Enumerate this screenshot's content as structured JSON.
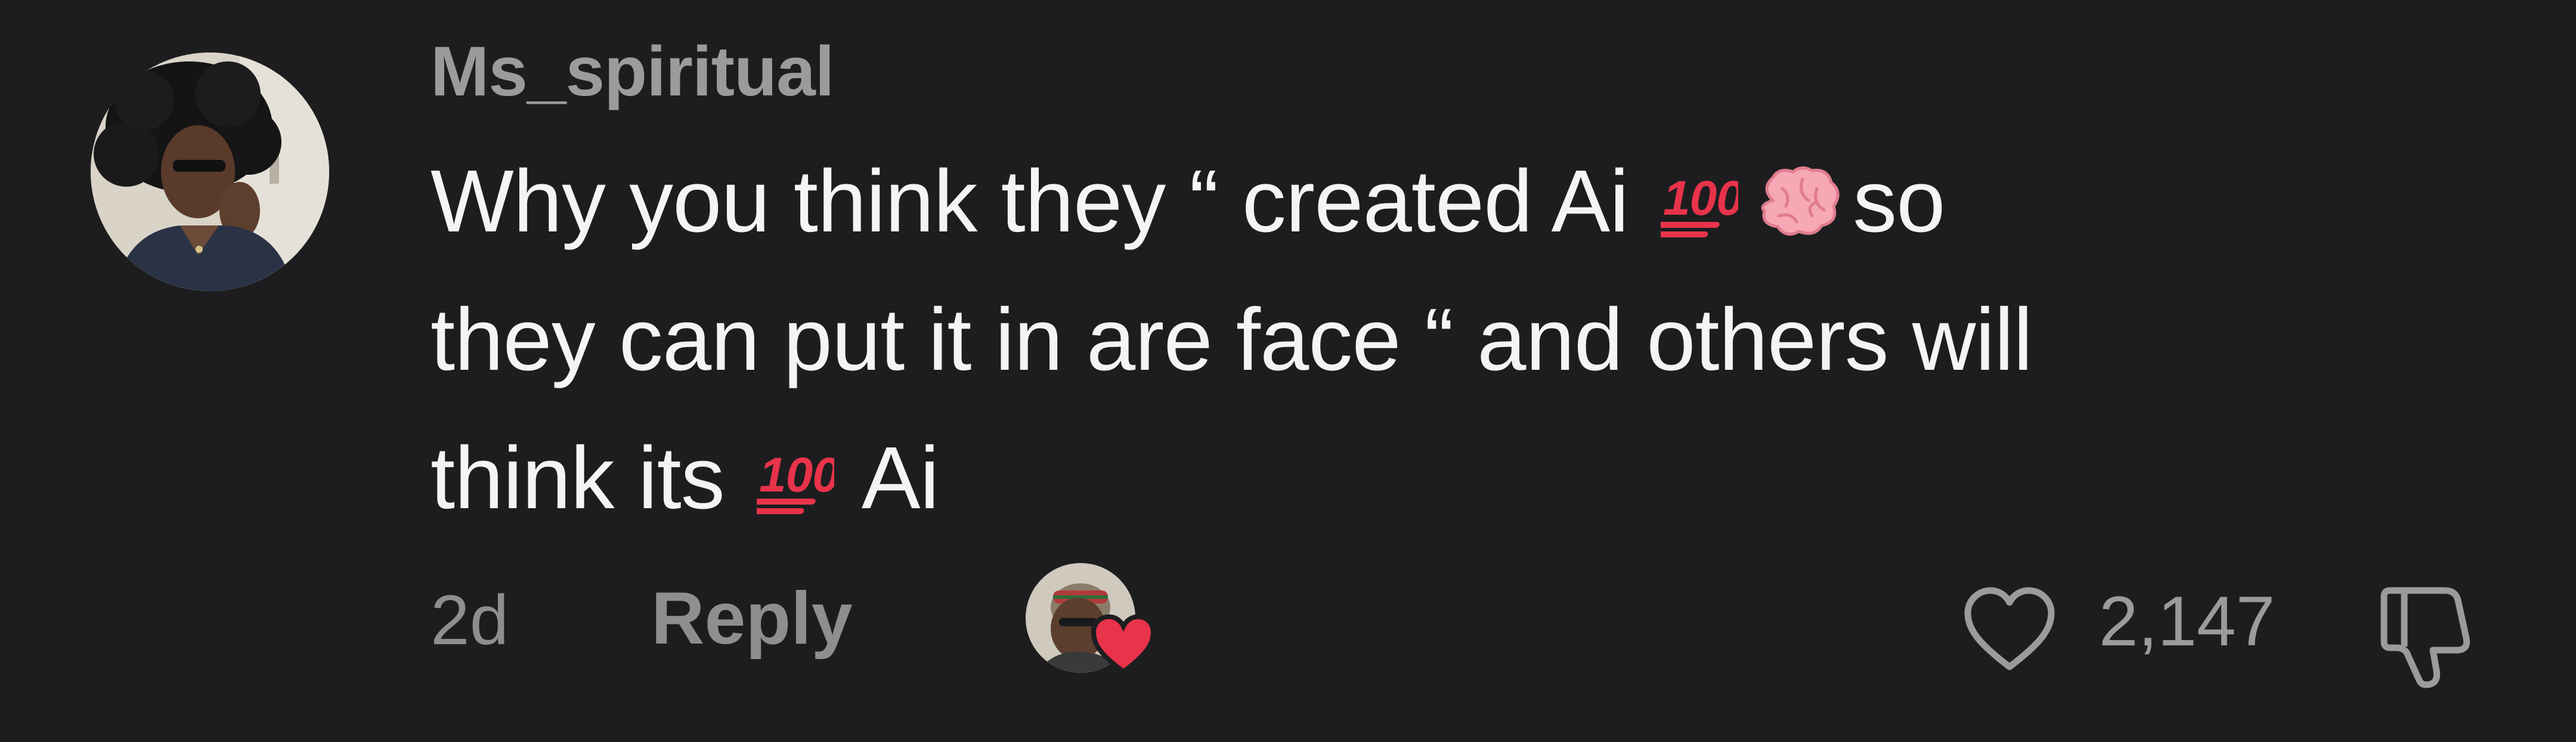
{
  "comment": {
    "username": "Ms_spiritual",
    "text_lines": [
      {
        "before": "Why you think they “ created Ai ",
        "after": "so"
      },
      {
        "text": "they can put it in are face “ and others will"
      },
      {
        "before": "think its ",
        "after": " Ai"
      }
    ],
    "emoji_names": [
      "hundred-points-emoji",
      "brain-emoji",
      "hundred-points-emoji"
    ],
    "timestamp": "2d",
    "reply_label": "Reply",
    "like_count": "2,147",
    "liked_by_creator": true
  },
  "icons": {
    "like": "heart-outline-icon",
    "dislike": "thumbs-down-icon",
    "creator_heart": "red-heart-icon"
  },
  "colors": {
    "background": "#1d1d1f",
    "text": "#f4f4f5",
    "muted": "#8e8e90",
    "heart_red": "#e8334a"
  }
}
